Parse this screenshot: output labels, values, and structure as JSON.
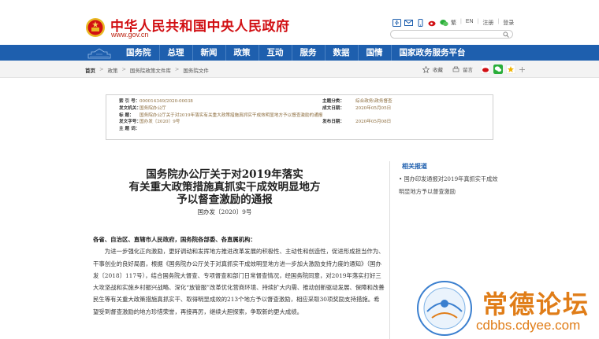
{
  "header": {
    "site_title": "中华人民共和国中央人民政府",
    "site_url": "www.gov.cn",
    "links": [
      "繁",
      "EN",
      "注册",
      "登录"
    ],
    "top_icons": [
      "accessibility-icon",
      "mail-icon",
      "phone-icon",
      "weibo-icon",
      "wechat-icon"
    ],
    "search_placeholder": ""
  },
  "nav": {
    "items": [
      "国务院",
      "总理",
      "新闻",
      "政策",
      "互动",
      "服务",
      "数据",
      "国情",
      "国家政务服务平台"
    ]
  },
  "breadcrumb": {
    "items": [
      "首页",
      "政策",
      "国务院政策文件库",
      "国务院文件"
    ],
    "tools": {
      "favorite": "收藏",
      "print": "留言"
    }
  },
  "info": {
    "index_label": "索 引 号：",
    "index_value": "000014349/2020-00038",
    "category_label": "主题分类：",
    "category_value": "综合政务\\政务督查",
    "issuer_label": "发文机关：",
    "issuer_value": "国务院办公厅",
    "date_label": "成文日期：",
    "date_value": "2020年05月05日",
    "title_label": "标      题：",
    "title_value": "国务院办公厅关于对2019年落实有关重大政策措施真抓实干成效明显地方予以督查激励的通报",
    "docno_label": "发文字号：",
    "docno_value": "国办发〔2020〕9号",
    "pubdate_label": "发布日期：",
    "pubdate_value": "2020年05月08日",
    "keywords_label": "主 题 词：",
    "keywords_value": ""
  },
  "article": {
    "title_line1": "国务院办公厅关于对2019年落实",
    "title_line2": "有关重大政策措施真抓实干成效明显地方",
    "title_line3": "予以督查激励的通报",
    "doc_number": "国办发〔2020〕9号",
    "salutation": "各省、自治区、直辖市人民政府，国务院各部委、各直属机构：",
    "paragraph": "为进一步强化正向激励，更好调动和发挥地方推进改革发展的积极性、主动性和创造性，促进形成担当作为、干事创业的良好局面，根据《国务院办公厅关于对真抓实干成效明显地方进一步加大激励支持力度的通知》（国办发〔2018〕117号），结合国务院大督查、专项督查和部门日常督查情况，经国务院同意，对2019年落实打好三大攻坚战和实施乡村振兴战略、深化“放管服”改革优化营商环境、持续扩大内需、推动创新驱动发展、保障和改善民生等有关重大政策措施真抓实干、取得明显成效的213个地方予以督查激励，相应采取30项奖励支持措施。希望受到督查激励的地方珍惜荣誉，再接再厉，继续大胆探索，争取新的更大成绩。"
  },
  "related": {
    "title": "相关报道",
    "items": [
      "国办印发通报对2019年真抓实干成效明显地方予以督查激励"
    ]
  },
  "watermark": {
    "brand_text": "常德论坛",
    "url_text": "cdbbs.cdyee.com",
    "badge_text": "常德论坛",
    "badge_url": "cdbbs.cdyee.com"
  },
  "colors": {
    "brand_red": "#d10f13",
    "nav_blue": "#1e5fae",
    "watermark_orange": "#e07d18"
  }
}
